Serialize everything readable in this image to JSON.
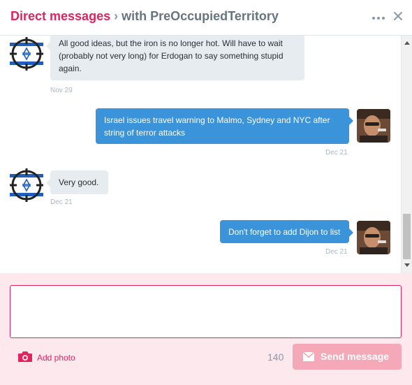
{
  "header": {
    "dm_label": "Direct messages",
    "separator": "›",
    "with_label": "with PreOccupiedTerritory",
    "more_icon": "more-dots-icon",
    "close_icon": "close-icon"
  },
  "messages": [
    {
      "direction": "in",
      "avatar": "israel-flag-crosshair-icon",
      "text": "All good ideas, but the iron is no longer hot. Will have to wait (probably not very long) for Erdogan to say something stupid again.",
      "time": "Nov 29"
    },
    {
      "direction": "out",
      "avatar": "user-photo-avatar",
      "text": "Israel issues travel warning to Malmo, Sydney and NYC after string of terror attacks",
      "time": "Dec 21"
    },
    {
      "direction": "in",
      "avatar": "israel-flag-crosshair-icon",
      "text": "Very good.",
      "time": "Dec 21"
    },
    {
      "direction": "out",
      "avatar": "user-photo-avatar",
      "text": "Don't forget to add Dijon to list",
      "time": "Dec 21"
    }
  ],
  "composer": {
    "input_value": "",
    "add_photo_label": "Add photo",
    "camera_icon": "camera-icon",
    "char_count": "140",
    "send_label": "Send message",
    "send_icon": "send-envelope-icon"
  },
  "colors": {
    "accent": "#e0245e",
    "bubble_out": "#3b94d9",
    "bubble_in": "#e6ecf0",
    "composer_bg": "#fde8ed",
    "send_disabled": "#f5a9b8"
  }
}
